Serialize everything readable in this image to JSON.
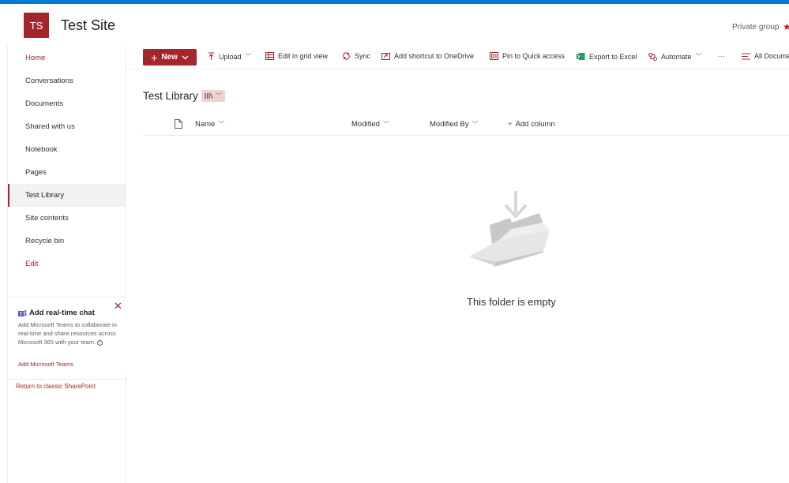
{
  "site": {
    "logo_initials": "TS",
    "title": "Test Site",
    "group_type": "Private group"
  },
  "nav": {
    "items": [
      {
        "label": "Home"
      },
      {
        "label": "Conversations"
      },
      {
        "label": "Documents"
      },
      {
        "label": "Shared with us"
      },
      {
        "label": "Notebook"
      },
      {
        "label": "Pages"
      },
      {
        "label": "Test Library"
      },
      {
        "label": "Site contents"
      },
      {
        "label": "Recycle bin"
      },
      {
        "label": "Edit"
      }
    ],
    "active": "Test Library"
  },
  "chat_card": {
    "title": "Add real-time chat",
    "description": "Add Microsoft Teams to collaborate in real-time and share resources across Microsoft 365 with your team.",
    "link": "Add Microsoft Teams"
  },
  "return_link": "Return to classic SharePoint",
  "command_bar": {
    "new_label": "New",
    "upload_label": "Upload",
    "grid_label": "Edit in grid view",
    "sync_label": "Sync",
    "shortcut_label": "Add shortcut to OneDrive",
    "pin_label": "Pin to Quick access",
    "export_label": "Export to Excel",
    "automate_label": "Automate",
    "more_label": "···",
    "all_docs_label": "All Documents"
  },
  "library": {
    "title": "Test Library",
    "columns": {
      "name": "Name",
      "modified": "Modified",
      "modified_by": "Modified By",
      "add_column": "Add column"
    },
    "empty_message": "This folder is empty"
  },
  "colors": {
    "brand": "#a4262c",
    "top_bar": "#0078d4",
    "nav_active_bg": "#f3f2f1"
  }
}
